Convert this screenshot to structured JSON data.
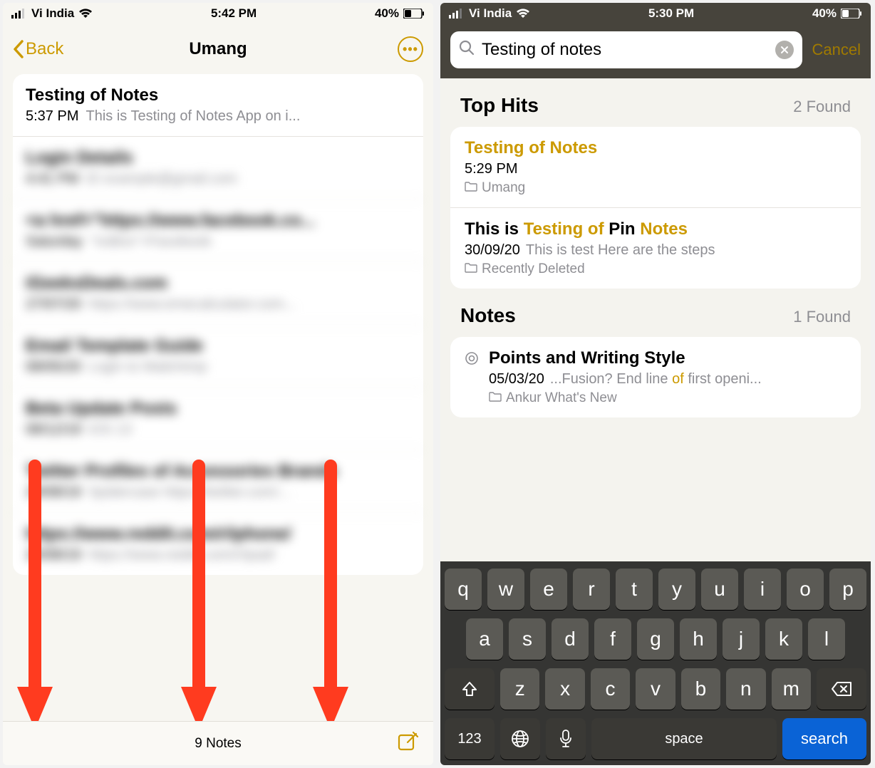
{
  "left": {
    "status": {
      "carrier": "Vi India",
      "time": "5:42 PM",
      "battery": "40%"
    },
    "nav": {
      "back": "Back",
      "title": "Umang"
    },
    "notes": [
      {
        "title": "Testing of Notes",
        "time": "5:37 PM",
        "preview": "This is Testing of Notes App on i...",
        "blurred": false
      },
      {
        "title": "Login Details",
        "time": "4:41 PM",
        "preview": "ID example@gmail.com",
        "blurred": true
      },
      {
        "title": "<a href=\"https://www.facebook.co...",
        "time": "Saturday",
        "preview": "\"noBox\">Facebook</a>",
        "blurred": true
      },
      {
        "title": "iGeeksDeals.com",
        "time": "27/07/20",
        "preview": "https://www.emecalculator.com...",
        "blurred": true
      },
      {
        "title": "Email Template Guide",
        "time": "08/05/20",
        "preview": "Login to Mailchimp",
        "blurred": true
      },
      {
        "title": "Beta Update Posts",
        "time": "08/12/19",
        "preview": "iOS 13",
        "blurred": true
      },
      {
        "title": "Twitter Profiles of Accessories Brands",
        "time": "29/08/19",
        "preview": "Spidercase https://twitter.com/...",
        "blurred": true
      },
      {
        "title": "https://www.reddit.com/r/iphone/",
        "time": "20/08/19",
        "preview": "https://www.reddit.com/r/ipad/",
        "blurred": true
      }
    ],
    "toolbar": {
      "count": "9 Notes"
    }
  },
  "right": {
    "status": {
      "carrier": "Vi India",
      "time": "5:30 PM",
      "battery": "40%"
    },
    "search": {
      "query": "Testing of notes",
      "cancel": "Cancel"
    },
    "sections": {
      "tophits": {
        "title": "Top Hits",
        "count": "2 Found"
      },
      "notes": {
        "title": "Notes",
        "count": "1 Found"
      }
    },
    "tophits": [
      {
        "title_parts": [
          {
            "t": "Testing of Notes",
            "hl": true
          }
        ],
        "time": "5:29 PM",
        "preview": "",
        "folder": "Umang"
      },
      {
        "title_parts": [
          {
            "t": "This is ",
            "hl": false
          },
          {
            "t": "Testing of",
            "hl": true
          },
          {
            "t": " Pin ",
            "hl": false
          },
          {
            "t": "Notes",
            "hl": true
          }
        ],
        "time": "30/09/20",
        "preview": "This is test Here are the steps",
        "folder": "Recently Deleted"
      }
    ],
    "notes_results": [
      {
        "title": "Points and Writing Style",
        "time": "05/03/20",
        "preview_parts": [
          {
            "t": "...Fusion? End line ",
            "hl": false
          },
          {
            "t": "of",
            "hl": true
          },
          {
            "t": " first openi...",
            "hl": false
          }
        ],
        "folder": "Ankur What's New"
      }
    ],
    "keyboard": {
      "row1": [
        "q",
        "w",
        "e",
        "r",
        "t",
        "y",
        "u",
        "i",
        "o",
        "p"
      ],
      "row2": [
        "a",
        "s",
        "d",
        "f",
        "g",
        "h",
        "j",
        "k",
        "l"
      ],
      "row3": [
        "z",
        "x",
        "c",
        "v",
        "b",
        "n",
        "m"
      ],
      "k123": "123",
      "space": "space",
      "search": "search"
    }
  }
}
